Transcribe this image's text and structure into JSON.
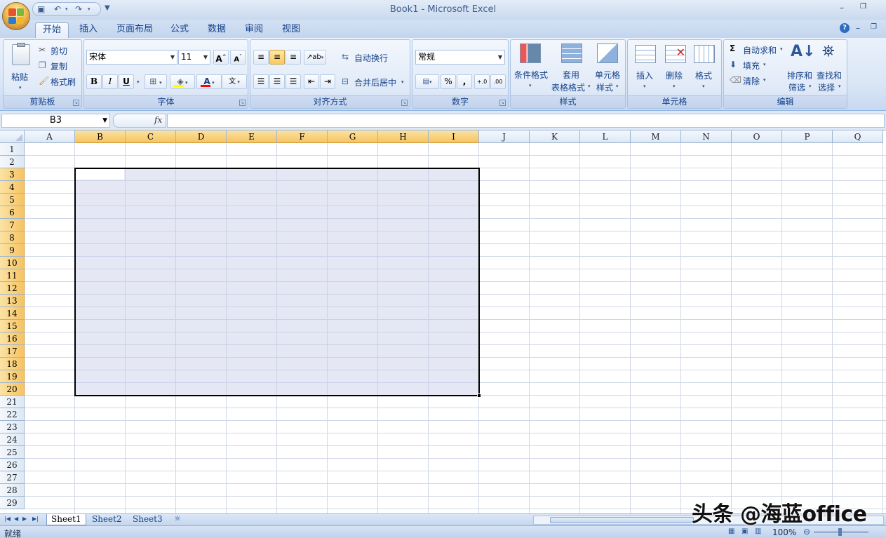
{
  "app": {
    "window_title": "Book1 - Microsoft Excel"
  },
  "tabs": [
    {
      "label": "开始",
      "active": true
    },
    {
      "label": "插入"
    },
    {
      "label": "页面布局"
    },
    {
      "label": "公式"
    },
    {
      "label": "数据"
    },
    {
      "label": "审阅"
    },
    {
      "label": "视图"
    }
  ],
  "ribbon": {
    "clipboard": {
      "paste": "粘贴",
      "cut": "剪切",
      "copy": "复制",
      "format_painter": "格式刷",
      "label": "剪贴板"
    },
    "font": {
      "name": "宋体",
      "size": "11",
      "bold": "B",
      "italic": "I",
      "underline": "U",
      "label": "字体"
    },
    "alignment": {
      "wrap": "自动换行",
      "merge": "合并后居中",
      "label": "对齐方式"
    },
    "number": {
      "format": "常规",
      "percent": "%",
      "comma": ",",
      "label": "数字"
    },
    "styles": {
      "conditional": "条件格式",
      "table1": "套用",
      "table2": "表格格式",
      "cell1": "单元格",
      "cell2": "样式",
      "label": "样式"
    },
    "cells": {
      "insert": "插入",
      "delete": "删除",
      "format": "格式",
      "label": "单元格"
    },
    "editing": {
      "autosum": "自动求和",
      "fill": "填充",
      "clear": "清除",
      "sort1": "排序和",
      "sort2": "筛选",
      "find1": "查找和",
      "find2": "选择",
      "label": "编辑"
    }
  },
  "formula_bar": {
    "name_box": "B3",
    "fx": "fx",
    "content": ""
  },
  "columns": [
    "A",
    "B",
    "C",
    "D",
    "E",
    "F",
    "G",
    "H",
    "I",
    "J",
    "K",
    "L",
    "M",
    "N",
    "O",
    "P",
    "Q"
  ],
  "rows": [
    "1",
    "2",
    "3",
    "4",
    "5",
    "6",
    "7",
    "8",
    "9",
    "10",
    "11",
    "12",
    "13",
    "14",
    "15",
    "16",
    "17",
    "18",
    "19",
    "20",
    "21",
    "22",
    "23",
    "24",
    "25",
    "26",
    "27",
    "28",
    "29"
  ],
  "selection": {
    "range": "B3:I20",
    "active_cell": "B3"
  },
  "sheets": [
    {
      "label": "Sheet1",
      "active": true
    },
    {
      "label": "Sheet2"
    },
    {
      "label": "Sheet3"
    }
  ],
  "status": {
    "text": "就绪",
    "zoom": "100%"
  },
  "watermark": "头条 @海蓝office",
  "colors": {
    "selection_fill": "#c6cde6",
    "header_selected": "#f6c362",
    "accent": "#15428b"
  }
}
